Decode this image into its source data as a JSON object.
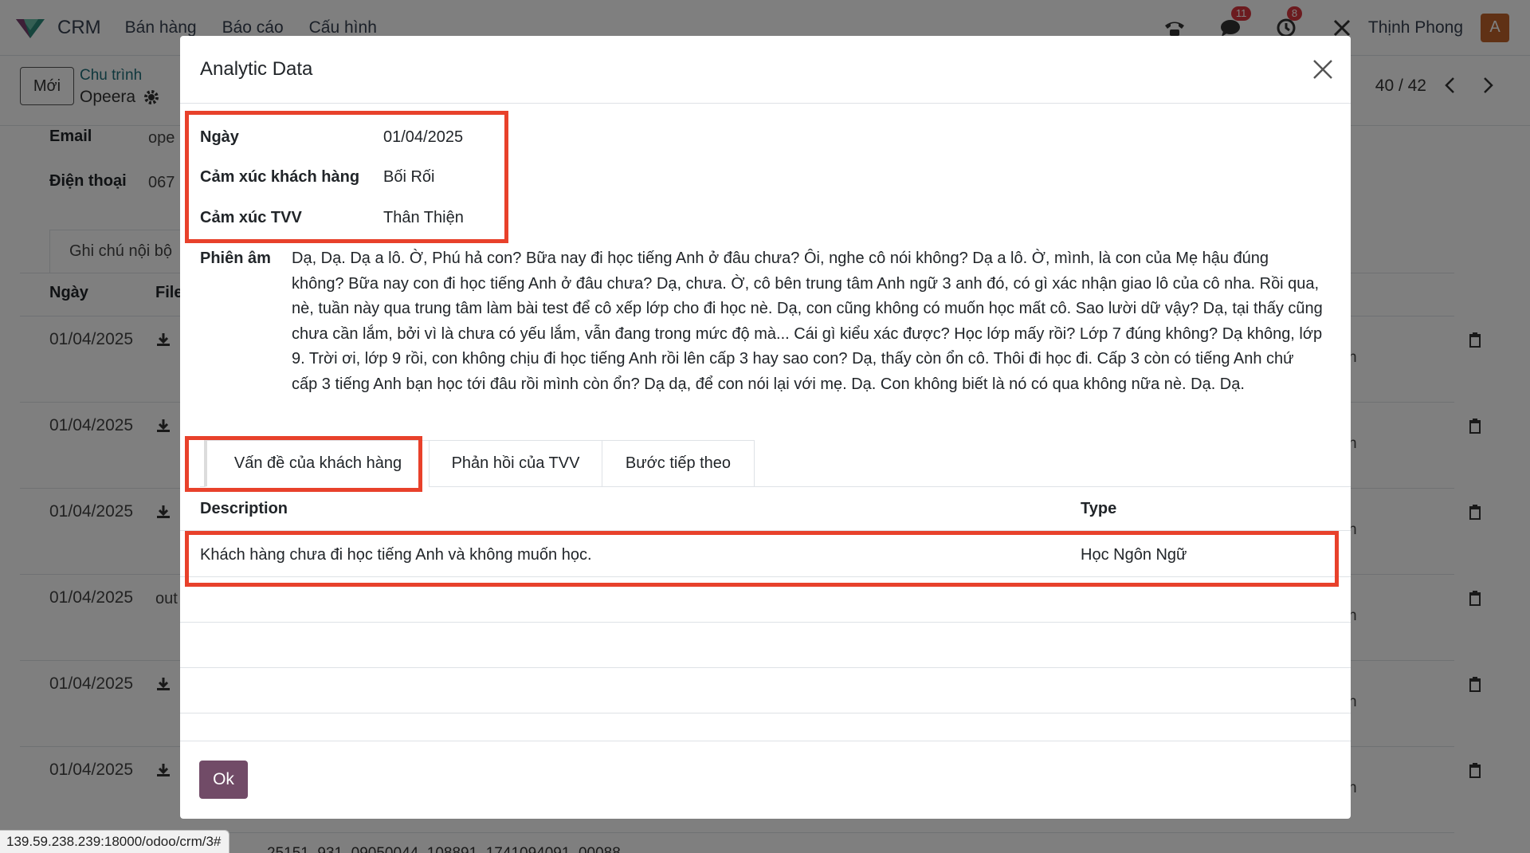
{
  "navbar": {
    "app_name": "CRM",
    "menu": [
      "Bán hàng",
      "Báo cáo",
      "Cấu hình"
    ],
    "messages_count": "11",
    "activities_count": "8",
    "user_name": "Thịnh Phong",
    "avatar_letter": "A"
  },
  "control_panel": {
    "new_button": "Mới",
    "breadcrumb_parent": "Chu trình",
    "breadcrumb_current": "Opeera",
    "pager": "40 / 42"
  },
  "background_form": {
    "email_label": "Email",
    "email_value": "ope",
    "phone_label": "Điện thoại",
    "phone_value": "067",
    "tab_label": "Ghi chú nội bộ",
    "col_date": "Ngày",
    "col_file": "File",
    "row_dates": [
      "01/04/2025",
      "01/04/2025",
      "01/04/2025",
      "01/04/2025",
      "01/04/2025",
      "01/04/2025"
    ],
    "row4_file": "out",
    "bottom_text": "25151_931_09050044_108891_1741094091_00088"
  },
  "status_url": "139.59.238.239:18000/odoo/crm/3#",
  "modal": {
    "title": "Analytic Data",
    "fields": {
      "date_label": "Ngày",
      "date_value": "01/04/2025",
      "customer_emotion_label": "Cảm xúc khách hàng",
      "customer_emotion_value": "Bối Rối",
      "agent_emotion_label": "Cảm xúc TVV",
      "agent_emotion_value": "Thân Thiện",
      "transcript_label": "Phiên âm",
      "transcript_value": "Dạ, Dạ. Dạ a lô. Ờ, Phú hả con? Bữa nay đi học tiếng Anh ở đâu chưa? Ôi, nghe cô nói không? Dạ a lô. Ờ, mình, là con của Mẹ hậu đúng không? Bữa nay con đi học tiếng Anh ở đâu chưa? Dạ, chưa. Ờ, cô bên trung tâm Anh ngữ 3 anh đó, có gì xác nhận giao lô của cô nha. Rồi qua, nè, tuần này qua trung tâm làm bài test để cô xếp lớp cho đi học nè. Dạ, con cũng không có muốn học mất cô. Sao lười dữ vậy? Dạ, tại thấy cũng chưa cần lắm, bởi vì là chưa có yếu lắm, vẫn đang trong mức độ mà... Cái gì kiểu xác được? Học lớp mấy rồi? Lớp 7 đúng không? Dạ không, lớp 9. Trời ơi, lớp 9 rồi, con không chịu đi học tiếng Anh rồi lên cấp 3 hay sao con? Dạ, thấy còn ổn cô. Thôi đi học đi. Cấp 3 còn có tiếng Anh chứ cấp 3 tiếng Anh bạn học tới đâu rồi mình còn ổn? Dạ dạ, để con nói lại với mẹ. Dạ. Con không biết là nó có qua không nữa nè. Dạ. Dạ."
    },
    "tabs": [
      "Vấn đề của khách hàng",
      "Phản hồi của TVV",
      "Bước tiếp theo"
    ],
    "table": {
      "headers": [
        "Description",
        "Type"
      ],
      "rows": [
        [
          "Khách hàng chưa đi học tiếng Anh và không muốn học.",
          "Học Ngôn Ngữ"
        ]
      ]
    },
    "ok_button": "Ok"
  },
  "colors": {
    "primary": "#714b67",
    "highlight": "#e8412b",
    "badge": "#d9363e",
    "link": "#1f6f7a"
  }
}
